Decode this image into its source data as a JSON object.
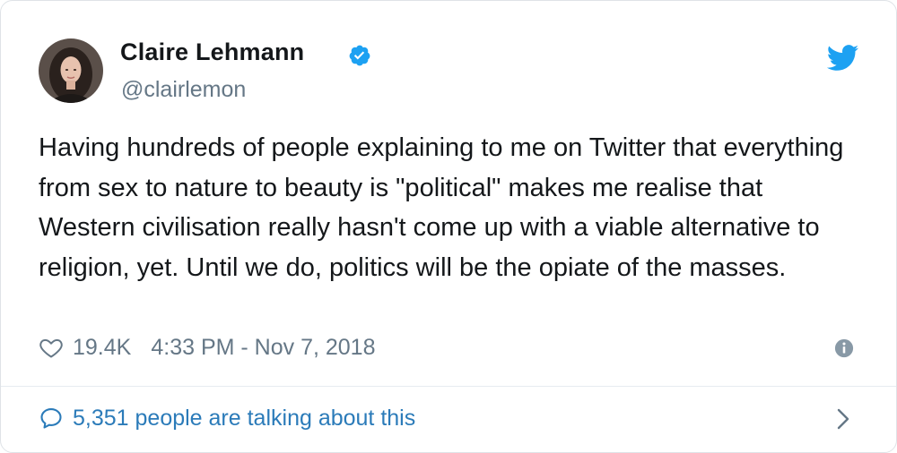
{
  "author": {
    "display_name": "Claire Lehmann",
    "handle": "@clairlemon",
    "verified": true,
    "avatar_icon": "profile-photo"
  },
  "tweet": {
    "text": "Having hundreds of people explaining to me on Twitter that everything from sex to nature to beauty is \"political\" makes me realise that Western civilisation really hasn't come up with a viable alternative to religion, yet. Until we do, politics will be the opiate of the masses.",
    "likes": "19.4K",
    "timestamp": "4:33 PM - Nov 7, 2018"
  },
  "footer": {
    "conversation_label": "5,351 people are talking about this"
  },
  "icons": {
    "brand": "twitter-bird-icon",
    "verified": "verified-badge-icon",
    "like": "heart-icon",
    "info": "info-icon",
    "reply": "speech-bubble-icon",
    "navigate": "chevron-right-icon"
  },
  "colors": {
    "twitter_blue": "#1da1f2",
    "link_blue": "#2b7bb9",
    "secondary_text": "#657786",
    "primary_text": "#14171a"
  }
}
